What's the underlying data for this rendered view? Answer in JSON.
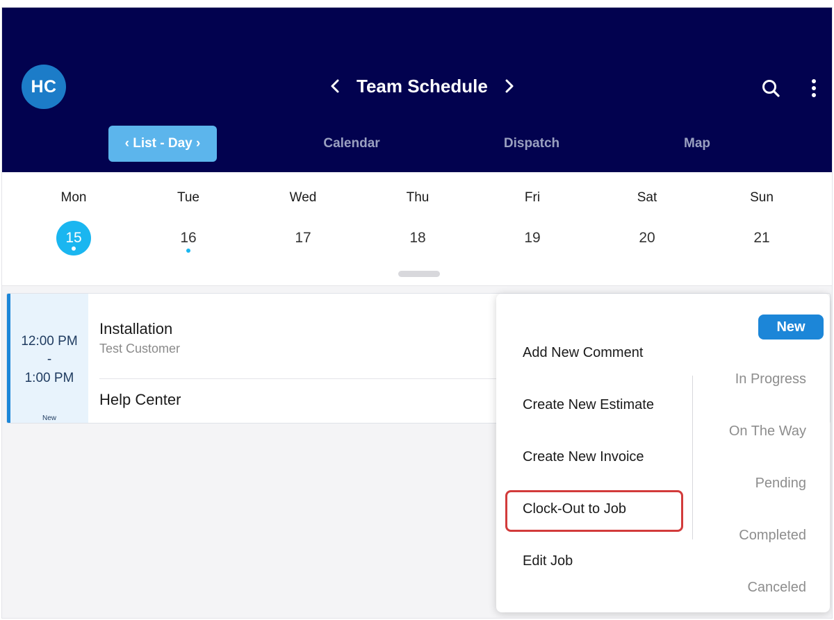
{
  "header": {
    "avatar_initials": "HC",
    "title": "Team Schedule",
    "tabs": [
      {
        "label": "‹ List - Day ›",
        "active": true
      },
      {
        "label": "Calendar",
        "active": false
      },
      {
        "label": "Dispatch",
        "active": false
      },
      {
        "label": "Map",
        "active": false
      }
    ]
  },
  "week": {
    "days": [
      {
        "name": "Mon",
        "num": "15",
        "selected": true,
        "has_event": true
      },
      {
        "name": "Tue",
        "num": "16",
        "selected": false,
        "has_event": true
      },
      {
        "name": "Wed",
        "num": "17",
        "selected": false,
        "has_event": false
      },
      {
        "name": "Thu",
        "num": "18",
        "selected": false,
        "has_event": false
      },
      {
        "name": "Fri",
        "num": "19",
        "selected": false,
        "has_event": false
      },
      {
        "name": "Sat",
        "num": "20",
        "selected": false,
        "has_event": false
      },
      {
        "name": "Sun",
        "num": "21",
        "selected": false,
        "has_event": false
      }
    ]
  },
  "job": {
    "start_time": "12:00 PM",
    "separator": "-",
    "end_time": "1:00 PM",
    "status": "New",
    "title": "Installation",
    "customer": "Test Customer",
    "help_link": "Help Center"
  },
  "popup": {
    "actions": [
      "Add New Comment",
      "Create New Estimate",
      "Create New Invoice",
      "Clock-Out to Job",
      "Edit Job"
    ],
    "current_status": "New",
    "statuses": [
      "In Progress",
      "On The Way",
      "Pending",
      "Completed",
      "Canceled"
    ]
  },
  "colors": {
    "header_bg": "#02024f",
    "active_tab": "#5cb5ec",
    "accent": "#1c86d8",
    "selected_day": "#1ab6f0",
    "highlight_border": "#d23b3b"
  },
  "icons": {
    "prev": "chevron-left-icon",
    "next": "chevron-right-icon",
    "search": "search-icon",
    "more": "more-vertical-icon"
  }
}
